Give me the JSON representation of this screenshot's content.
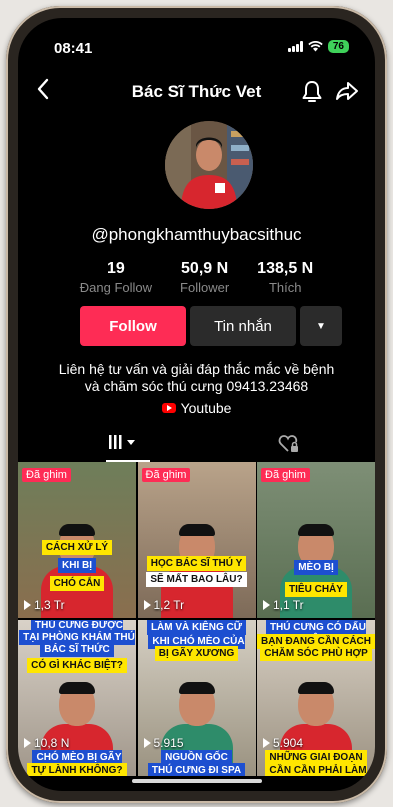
{
  "status": {
    "time": "08:41",
    "battery": "76"
  },
  "header": {
    "title": "Bác Sĩ Thức Vet",
    "back_icon": "chevron-left-icon",
    "bell_icon": "bell-icon",
    "share_icon": "share-arrow-icon"
  },
  "profile": {
    "username": "@phongkhamthuybacsithuc"
  },
  "stats": [
    {
      "value": "19",
      "label": "Đang Follow"
    },
    {
      "value": "50,9 N",
      "label": "Follower"
    },
    {
      "value": "138,5 N",
      "label": "Thích"
    }
  ],
  "actions": {
    "follow": "Follow",
    "message": "Tin nhắn",
    "more": "▼"
  },
  "bio": {
    "line1": "Liên hệ tư vấn và giải đáp thắc mắc về bệnh",
    "line2": "và chăm sóc thú cưng 09413.23468"
  },
  "link": {
    "label": "Youtube"
  },
  "tabs": {
    "videos_icon": "grid-icon",
    "liked_icon": "heart-lock-icon"
  },
  "pinned_label": "Đã ghim",
  "videos": [
    {
      "views": "1,3 Tr",
      "cap1": "CÁCH XỬ LÝ",
      "cap2": "KHI BỊ",
      "cap3": "CHÓ CẮN"
    },
    {
      "views": "1,2 Tr",
      "cap1": "HỌC BÁC SĨ THÚ Y",
      "cap2": "SẼ MẤT BAO LÂU?"
    },
    {
      "views": "1,1 Tr",
      "cap1": "MÈO BỊ",
      "cap2": "TIÊU CHẢY"
    },
    {
      "views": "10,8 N",
      "cap1": "THÚ CƯNG ĐƯỢC TẮM",
      "cap2": "TẠI PHÒNG KHÁM THÚ Y",
      "cap3": "BÁC SĨ THỨC",
      "cap4": "CÓ GÌ KHÁC BIỆT?",
      "cap5": "CHÓ MÈO BỊ GÃY XƯƠNG",
      "cap6": "TỰ LÀNH KHÔNG?"
    },
    {
      "views": "5.915",
      "cap1": "LÀM VÀ KIÊNG CỮ",
      "cap2": "KHI CHÓ MÈO CỦA BẠN",
      "cap3": "BỊ GÃY XƯƠNG",
      "cap4": "NGUỒN GỐC",
      "cap5": "THÚ CƯNG ĐI SPA"
    },
    {
      "views": "5.904",
      "cap1": "THÚ CƯNG CÓ DẤU HIỆU",
      "cap2": "BẠN ĐANG CẦN CÁCH",
      "cap3": "CHĂM SÓC PHÙ HỢP",
      "cap4": "NHỮNG GIAI ĐOẠN",
      "cap5": "CẦN CẦN PHẢI LÀM GÌ"
    }
  ]
}
